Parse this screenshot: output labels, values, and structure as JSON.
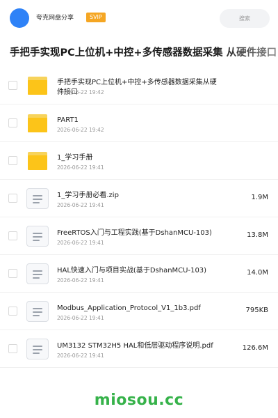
{
  "header": {
    "share_name": "夸克网盘分享",
    "badge": "SVIP",
    "search_placeholder": "搜索"
  },
  "title": "手把手实现PC上位机+中控+多传感器数据采集 从硬件接口",
  "items": [
    {
      "type": "folder",
      "name": "手把手实现PC上位机+中控+多传感器数据采集从硬件接口",
      "date": "2026-06-22 19:42",
      "size": ""
    },
    {
      "type": "folder",
      "name": "PART1",
      "date": "2026-06-22 19:42",
      "size": ""
    },
    {
      "type": "folder",
      "name": "1_学习手册",
      "date": "2026-06-22 19:41",
      "size": ""
    },
    {
      "type": "file",
      "name": "1_学习手册必看.zip",
      "date": "2026-06-22 19:41",
      "size": "1.9M"
    },
    {
      "type": "file",
      "name": "FreeRTOS入门与工程实践(基于DshanMCU-103)",
      "date": "2026-06-22 19:41",
      "size": "13.8M"
    },
    {
      "type": "file",
      "name": "HAL快速入门与项目实战(基于DshanMCU-103)",
      "date": "2026-06-22 19:41",
      "size": "14.0M"
    },
    {
      "type": "file",
      "name": "Modbus_Application_Protocol_V1_1b3.pdf",
      "date": "2026-06-22 19:41",
      "size": "795KB"
    },
    {
      "type": "file",
      "name": "UM3132 STM32H5 HAL和低层驱动程序说明.pdf",
      "date": "2026-06-22 19:41",
      "size": "126.6M"
    }
  ],
  "watermark": "miosou.cc",
  "colors": {
    "avatar": "#2e82f7",
    "badge": "#f5a623",
    "folder": "#fcc419",
    "watermark": "#36b24a"
  }
}
